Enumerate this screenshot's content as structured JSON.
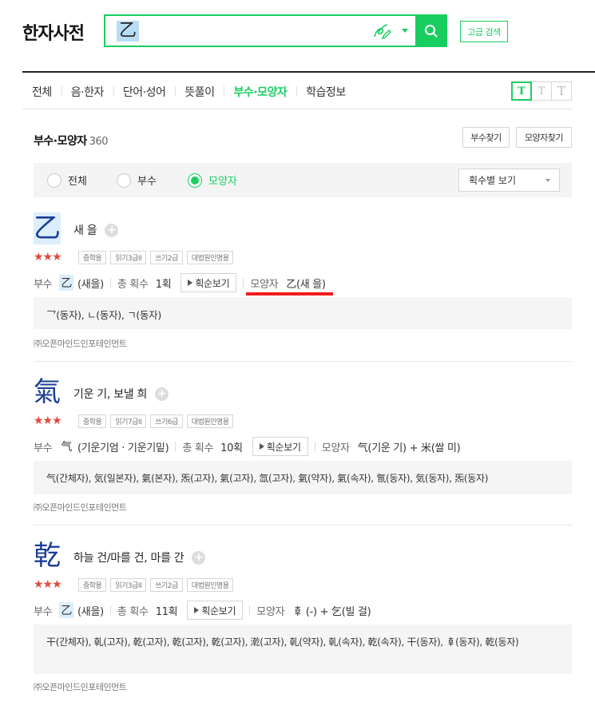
{
  "header": {
    "logo": "한자사전",
    "search_value": "乙",
    "advanced_search": "고급 검색"
  },
  "tabs": [
    {
      "label": "전체",
      "active": false
    },
    {
      "label": "음·한자",
      "active": false
    },
    {
      "label": "단어·성어",
      "active": false
    },
    {
      "label": "뜻풀이",
      "active": false
    },
    {
      "label": "부수·모양자",
      "active": true
    },
    {
      "label": "학습정보",
      "active": false
    }
  ],
  "font_size_buttons": [
    "T",
    "T",
    "T"
  ],
  "section": {
    "title": "부수·모양자",
    "count": "360",
    "find_radical": "부수찾기",
    "find_shape": "모양자찾기"
  },
  "filter": {
    "options": [
      "전체",
      "부수",
      "모양자"
    ],
    "selected": "모양자",
    "sort_label": "획수별 보기"
  },
  "labels": {
    "radical": "부수",
    "total_strokes": "총 획수",
    "stroke_order": "획순보기",
    "shape": "모양자"
  },
  "entries": [
    {
      "hanja": "乙",
      "meaning": "새 을",
      "stars": "★★★",
      "badges": [
        "중학용",
        "읽기3급II",
        "쓰기2급",
        "대법원인명용"
      ],
      "radical_char": "乙",
      "radical_desc": "(새을)",
      "strokes": "1획",
      "shape_value": "乙(새 을)",
      "variants": "乛(동자), ㄴ(동자), ㄱ(동자)",
      "source": "㈜오픈마인드인포테인먼트"
    },
    {
      "hanja": "氣",
      "meaning": "기운 기, 보낼 희",
      "stars": "★★★",
      "badges": [
        "중학용",
        "읽기7급II",
        "쓰기6급",
        "대법원인명용"
      ],
      "radical_char": "气",
      "radical_desc": "(기운기엄 · 기운기밑)",
      "strokes": "10획",
      "shape_value": "气(기운 기) + 米(쌀 미)",
      "variants": "气(간체자), 気(일본자), 氣(본자), 炁(고자), 氣(고자), 氙(고자), 氣(약자), 氣(속자), 氜(동자), 気(동자), 炁(동자)",
      "source": "㈜오픈마인드인포테인먼트"
    },
    {
      "hanja": "乾",
      "meaning": "하늘 건/마를 건, 마를 간",
      "stars": "★★★",
      "badges": [
        "중학용",
        "읽기3급II",
        "쓰기2급",
        "대법원인명용"
      ],
      "radical_char": "乙",
      "radical_desc": "(새을)",
      "strokes": "11획",
      "shape_value": "𠦝 (-) + 乞(빌 걸)",
      "variants": "干(간체자), 乹(고자), 乾(고자), 乾(고자), 乾(고자), 漧(고자), 乹(약자), 乹(속자), 乾(속자), 干(동자), 𠦝(동자), 乾(동자)",
      "source": "㈜오픈마인드인포테인먼트"
    }
  ]
}
